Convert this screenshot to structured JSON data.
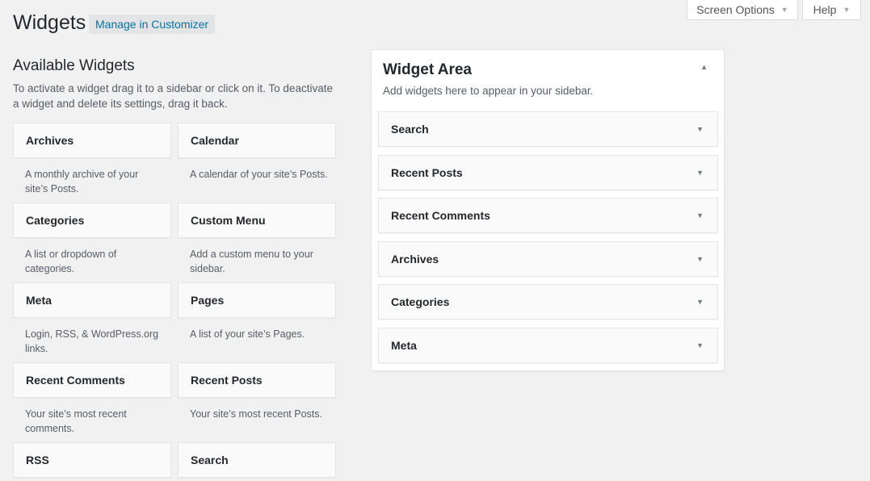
{
  "header": {
    "title": "Widgets",
    "manage_label": "Manage in Customizer",
    "screen_options_label": "Screen Options",
    "help_label": "Help",
    "caret": "▼"
  },
  "available": {
    "title": "Available Widgets",
    "description": "To activate a widget drag it to a sidebar or click on it. To deactivate a widget and delete its settings, drag it back.",
    "widgets": [
      {
        "name": "Archives",
        "description": "A monthly archive of your site’s Posts."
      },
      {
        "name": "Calendar",
        "description": "A calendar of your site’s Posts."
      },
      {
        "name": "Categories",
        "description": "A list or dropdown of categories."
      },
      {
        "name": "Custom Menu",
        "description": "Add a custom menu to your sidebar."
      },
      {
        "name": "Meta",
        "description": "Login, RSS, & WordPress.org links."
      },
      {
        "name": "Pages",
        "description": "A list of your site’s Pages."
      },
      {
        "name": "Recent Comments",
        "description": "Your site’s most recent comments."
      },
      {
        "name": "Recent Posts",
        "description": "Your site’s most recent Posts."
      },
      {
        "name": "RSS",
        "description": ""
      },
      {
        "name": "Search",
        "description": ""
      }
    ]
  },
  "sidebar": {
    "title": "Widget Area",
    "description": "Add widgets here to appear in your sidebar.",
    "toggle_icon": "▲",
    "caret": "▼",
    "widgets": [
      {
        "name": "Search"
      },
      {
        "name": "Recent Posts"
      },
      {
        "name": "Recent Comments"
      },
      {
        "name": "Archives"
      },
      {
        "name": "Categories"
      },
      {
        "name": "Meta"
      }
    ]
  },
  "colors": {
    "background": "#f1f1f1",
    "link": "#0073aa",
    "text": "#23282d",
    "muted": "#555d66"
  }
}
